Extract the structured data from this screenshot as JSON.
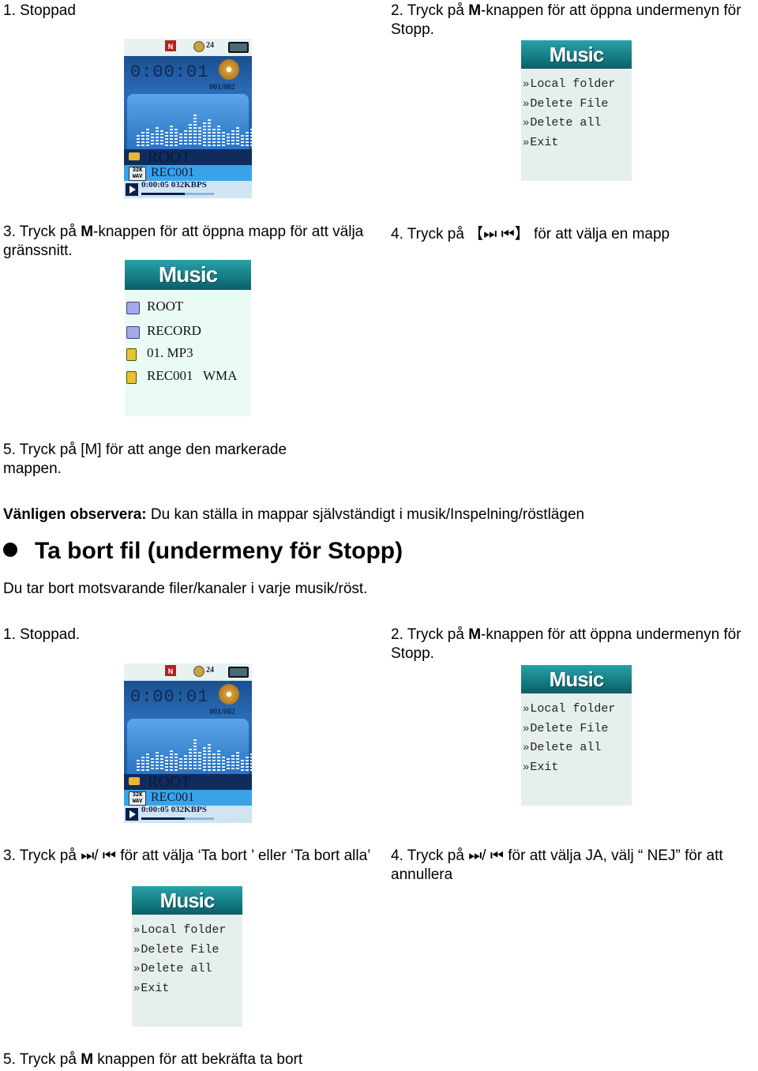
{
  "section1": {
    "step1": "1. Stoppad",
    "step2_prefix": "2. Tryck på ",
    "step2_bold": "M",
    "step2_suffix": "-knappen för att öppna undermenyn för Stopp.",
    "step3_prefix": "3. Tryck på ",
    "step3_bold": "M",
    "step3_suffix": "-knappen för att öppna mapp för att välja gränssnitt.",
    "step4": "4. Tryck på 【⏭ ⏮】 för att välja en mapp",
    "step5": "5. Tryck på [M] för att ange den markerade mappen."
  },
  "note": {
    "label": "Vänligen observera:",
    "text": " Du kan ställa in mappar självständigt i musik/Inspelning/röstlägen"
  },
  "heading": "Ta bort fil (undermeny för Stopp)",
  "intro": "Du tar bort motsvarande filer/kanaler i varje musik/röst.",
  "section2": {
    "step1": "1. Stoppad.",
    "step2_prefix": "2. Tryck på ",
    "step2_bold": "M",
    "step2_suffix": "-knappen för att öppna undermenyn för Stopp.",
    "step3": "3. Tryck på ⏭/ ⏮ för att välja ‘Ta bort ’ eller ‘Ta bort alla’",
    "step4": "4. Tryck på ⏭/ ⏮ för att välja JA, välj “ NEJ” för att annullera",
    "step5_prefix": "5. Tryck på ",
    "step5_bold": "M",
    "step5_suffix": " knappen för att bekräfta ta bort"
  },
  "player": {
    "n_badge": "N",
    "volume": "24",
    "time": "0:00:01",
    "track_count": "001/002",
    "folder": "ROOT",
    "file_badge": "32K WAV",
    "file": "REC001",
    "status": "0:00:05 032KBPS",
    "progress": 0.6
  },
  "music_menu": {
    "title": "Music",
    "items": [
      "Local folder",
      "Delete File",
      "Delete all",
      "Exit"
    ]
  },
  "folder_browser": {
    "title": "Music",
    "items": [
      {
        "type": "folder",
        "label": "ROOT"
      },
      {
        "type": "folder",
        "label": "RECORD"
      },
      {
        "type": "file",
        "label": "01. MP3"
      },
      {
        "type": "file",
        "label": "REC001   WMA"
      }
    ]
  }
}
